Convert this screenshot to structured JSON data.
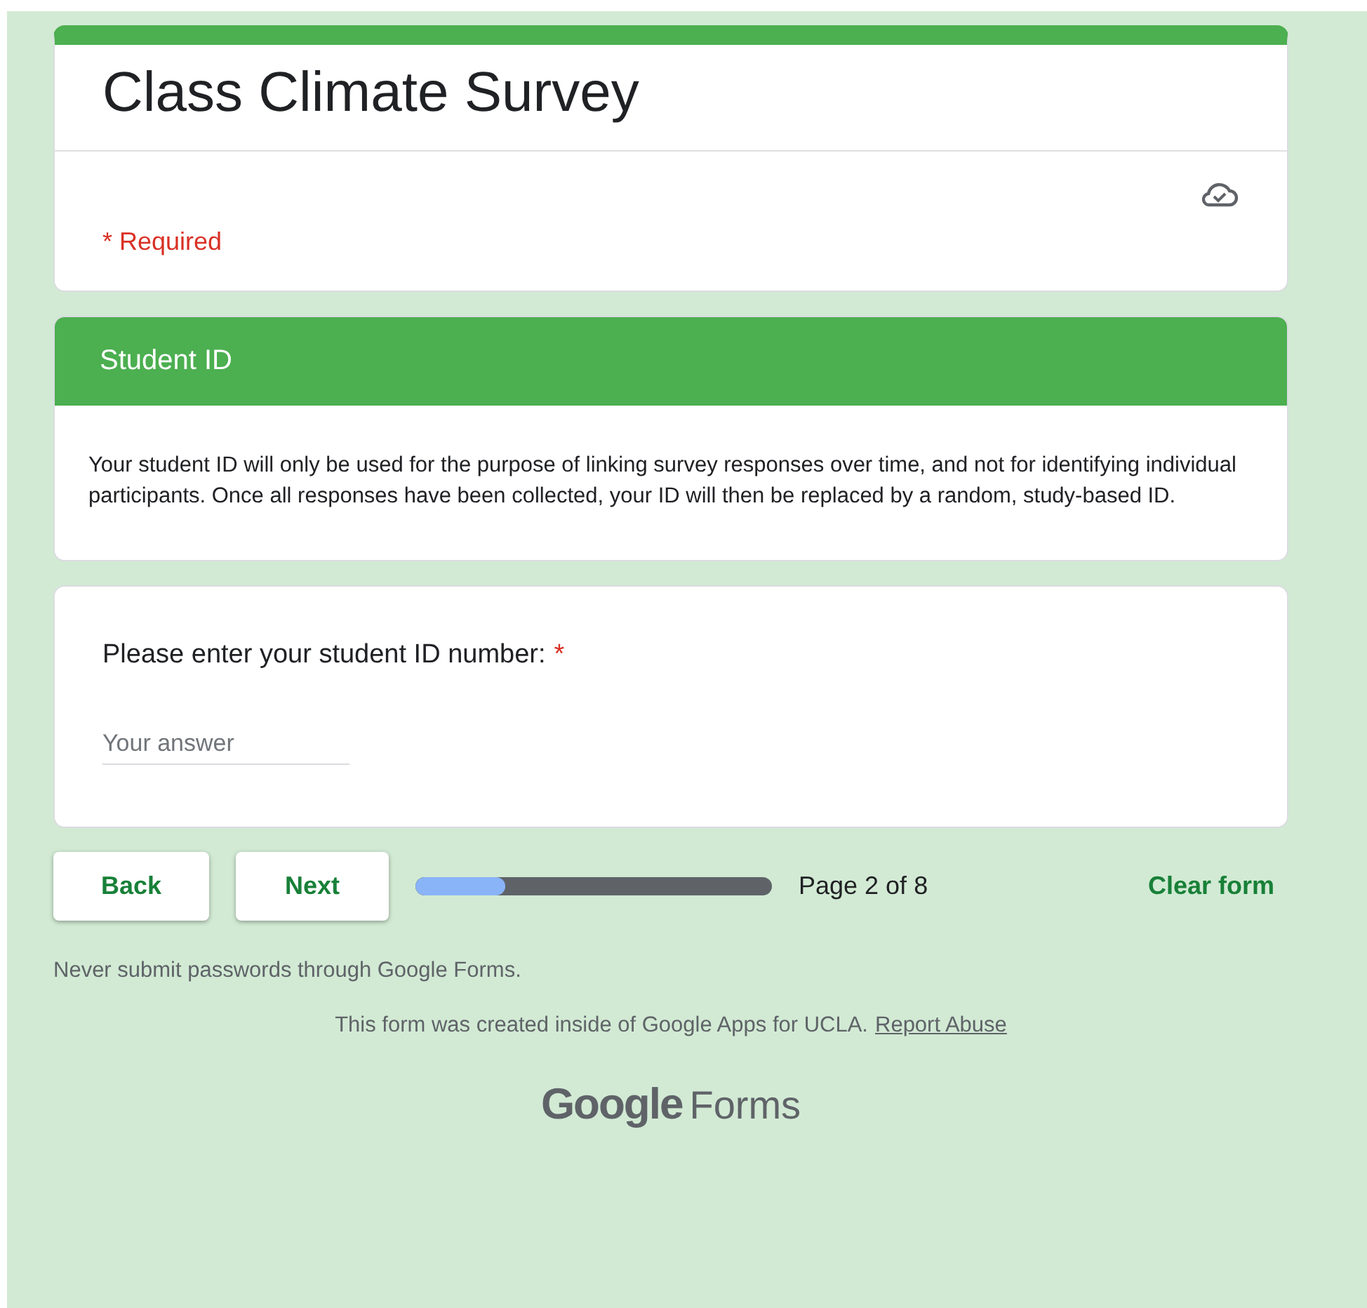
{
  "header": {
    "title": "Class Climate Survey",
    "required_note": "* Required"
  },
  "section": {
    "title": "Student ID",
    "description": "Your student ID will only be used for the purpose of linking survey responses over time, and not for identifying individual participants. Once all responses have been collected, your ID will then be replaced by a random, study-based ID."
  },
  "question": {
    "label": "Please enter your student ID number:",
    "required_mark": "*",
    "placeholder": "Your answer"
  },
  "navigation": {
    "buttons": [
      "Back",
      "Next"
    ],
    "progress": {
      "level": 0.25,
      "text": "Page 2 of 8"
    },
    "clear": "Clear form"
  },
  "footer": {
    "warning": "Never submit passwords through Google Forms.",
    "note": "This form was created inside of Google Apps for UCLA.",
    "link": "Report Abuse",
    "logo": {
      "brand": "Google",
      "product": "Forms"
    }
  }
}
